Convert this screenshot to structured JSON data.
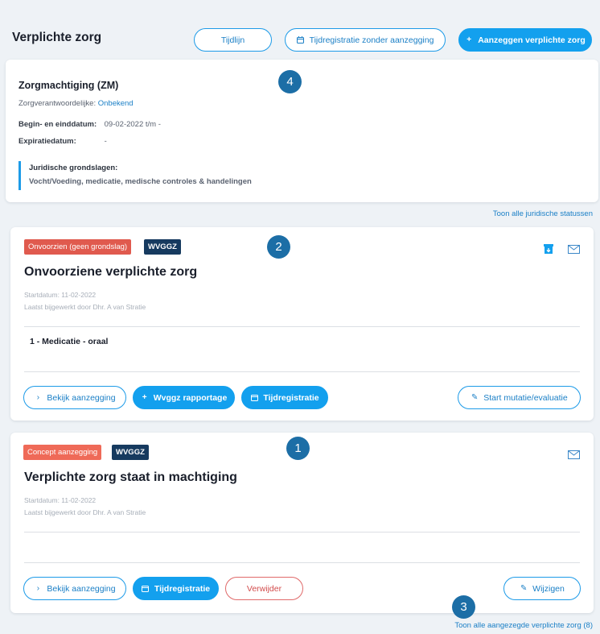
{
  "header": {
    "title": "Verplichte zorg",
    "btn_tijdlijn": "Tijdlijn",
    "btn_tijdregistratie": "Tijdregistratie zonder aanzegging",
    "btn_aanzeggen": "Aanzeggen verplichte zorg"
  },
  "zm": {
    "title": "Zorgmachtiging (ZM)",
    "verantw_label": "Zorgverantwoordelijke:",
    "verantw_value": "Onbekend",
    "dates_label": "Begin- en einddatum:",
    "dates_value": "09-02-2022 t/m -",
    "exp_label": "Expiratiedatum:",
    "exp_value": "-",
    "juri_heading": "Juridische grondslagen:",
    "juri_value": "Vocht/Voeding, medicatie, medische controles & handelingen"
  },
  "link_statussen": "Toon alle juridische statussen",
  "card1": {
    "badge_status": "Onvoorzien (geen grondslag)",
    "badge_type": "WVGGZ",
    "title": "Onvoorziene verplichte zorg",
    "startdatum": "Startdatum: 11-02-2022",
    "bijgewerkt": "Laatst bijgewerkt door Dhr. A van Stratie",
    "item": "1 - Medicatie - oraal",
    "btn_bekijk": "Bekijk aanzegging",
    "btn_rapportage": "Wvggz rapportage",
    "btn_tijdreg": "Tijdregistratie",
    "btn_mutatie": "Start mutatie/evaluatie"
  },
  "card2": {
    "badge_status": "Concept aanzegging",
    "badge_type": "WVGGZ",
    "title": "Verplichte zorg staat in machtiging",
    "startdatum": "Startdatum: 11-02-2022",
    "bijgewerkt": "Laatst bijgewerkt door Dhr. A van Stratie",
    "btn_bekijk": "Bekijk aanzegging",
    "btn_tijdreg": "Tijdregistratie",
    "btn_verwijder": "Verwijder",
    "btn_wijzigen": "Wijzigen"
  },
  "link_aangezegd": "Toon alle aangezegde verplichte zorg (8)",
  "markers": [
    "1",
    "2",
    "3",
    "4"
  ],
  "colors": {
    "accent": "#13a0ee",
    "badge_red": "#e05a4e",
    "badge_dark": "#163a5f",
    "marker": "#1c6ea6"
  },
  "icons": [
    "plus-icon",
    "calendar-icon",
    "chevron-right-icon",
    "pencil-icon",
    "archive-icon",
    "mail-icon"
  ]
}
